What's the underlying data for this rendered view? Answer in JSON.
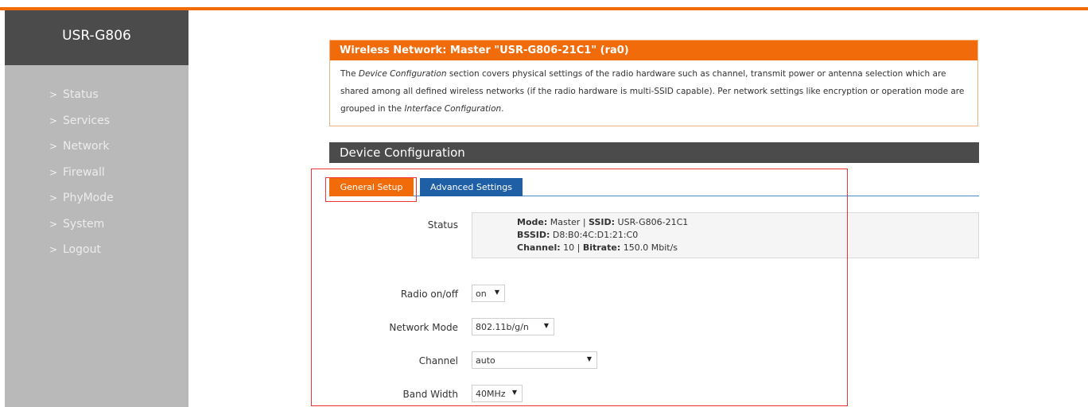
{
  "brand": "USR-G806",
  "menu": [
    {
      "label": "Status"
    },
    {
      "label": "Services"
    },
    {
      "label": "Network"
    },
    {
      "label": "Firewall"
    },
    {
      "label": "PhyMode"
    },
    {
      "label": "System"
    },
    {
      "label": "Logout"
    }
  ],
  "info": {
    "title": "Wireless Network: Master \"USR-G806-21C1\" (ra0)",
    "text_1": "The ",
    "em_1": "Device Configuration",
    "text_2": " section covers physical settings of the radio hardware such as channel, transmit power or antenna selection which are shared among all defined wireless networks (if the radio hardware is multi-SSID capable). Per network settings like encryption or operation mode are grouped in the ",
    "em_2": "Interface Configuration",
    "text_3": "."
  },
  "section_title": "Device Configuration",
  "tabs": {
    "general": "General Setup",
    "advanced": "Advanced Settings"
  },
  "status": {
    "label": "Status",
    "mode_label": "Mode:",
    "mode_value": "Master",
    "ssid_label": "SSID:",
    "ssid_value": "USR-G806-21C1",
    "bssid_label": "BSSID:",
    "bssid_value": "D8:B0:4C:D1:21:C0",
    "channel_label": "Channel:",
    "channel_value": "10",
    "bitrate_label": "Bitrate:",
    "bitrate_value": "150.0 Mbit/s",
    "sep": "|"
  },
  "fields": {
    "radio": {
      "label": "Radio on/off",
      "value": "on"
    },
    "mode": {
      "label": "Network Mode",
      "value": "802.11b/g/n"
    },
    "channel": {
      "label": "Channel",
      "value": "auto"
    },
    "bandwidth": {
      "label": "Band Width",
      "value": "40MHz"
    }
  },
  "colors": {
    "accent": "#f26b0a",
    "sidebar": "#b9b9b9",
    "header_dark": "#4b4b4b",
    "tab_blue": "#1e5fa6",
    "highlight_border": "#e33333"
  }
}
